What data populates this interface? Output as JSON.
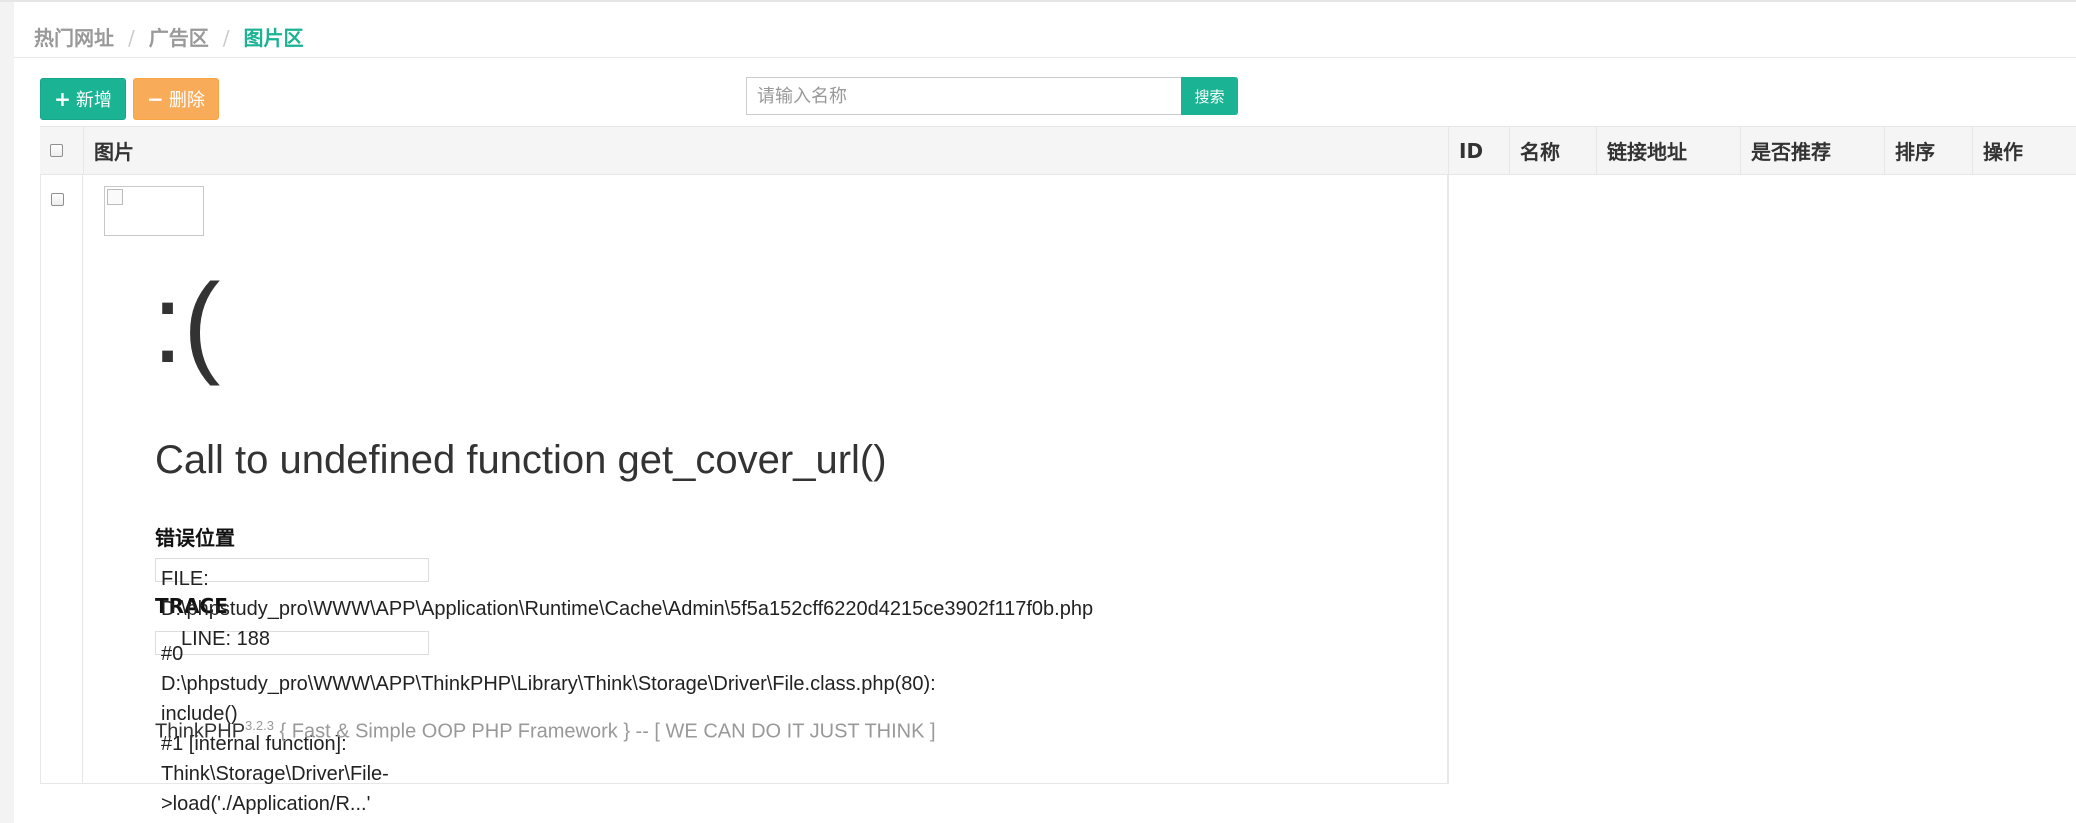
{
  "breadcrumb": {
    "items": [
      "热门网址",
      "广告区",
      "图片区"
    ],
    "separator": "/"
  },
  "toolbar": {
    "add_icon": "+",
    "add_label": "新增",
    "delete_icon": "−",
    "delete_label": "删除",
    "search_placeholder": "请输入名称",
    "search_label": "搜索"
  },
  "table": {
    "columns": [
      "图片",
      "ID",
      "名称",
      "链接地址",
      "是否推荐",
      "排序",
      "操作"
    ]
  },
  "error_page": {
    "face": ":(",
    "title": "Call to undefined function get_cover_url()",
    "position_heading": "错误位置",
    "file_label": "FILE:",
    "file_path": "D:\\phpstudy_pro\\WWW\\APP\\Application\\Runtime\\Cache\\Admin\\5f5a152cff6220d4215ce3902f117f0b.php",
    "line_label": "LINE: 188",
    "trace_heading": "TRACE",
    "trace_lines": [
      "#0",
      "D:\\phpstudy_pro\\WWW\\APP\\ThinkPHP\\Library\\Think\\Storage\\Driver\\File.class.php(80):",
      "include()",
      "#1 [internal function]:",
      "Think\\Storage\\Driver\\File-",
      ">load('./Application/R...'"
    ],
    "footer_brand": "ThinkPHP",
    "footer_version": "3.2.3",
    "footer_slogan": " { Fast & Simple OOP PHP Framework } -- [ WE CAN DO IT JUST THINK ]"
  },
  "colors": {
    "primary": "#1ab394",
    "warning": "#f8ac59",
    "header_bg": "#f5f5f6"
  }
}
